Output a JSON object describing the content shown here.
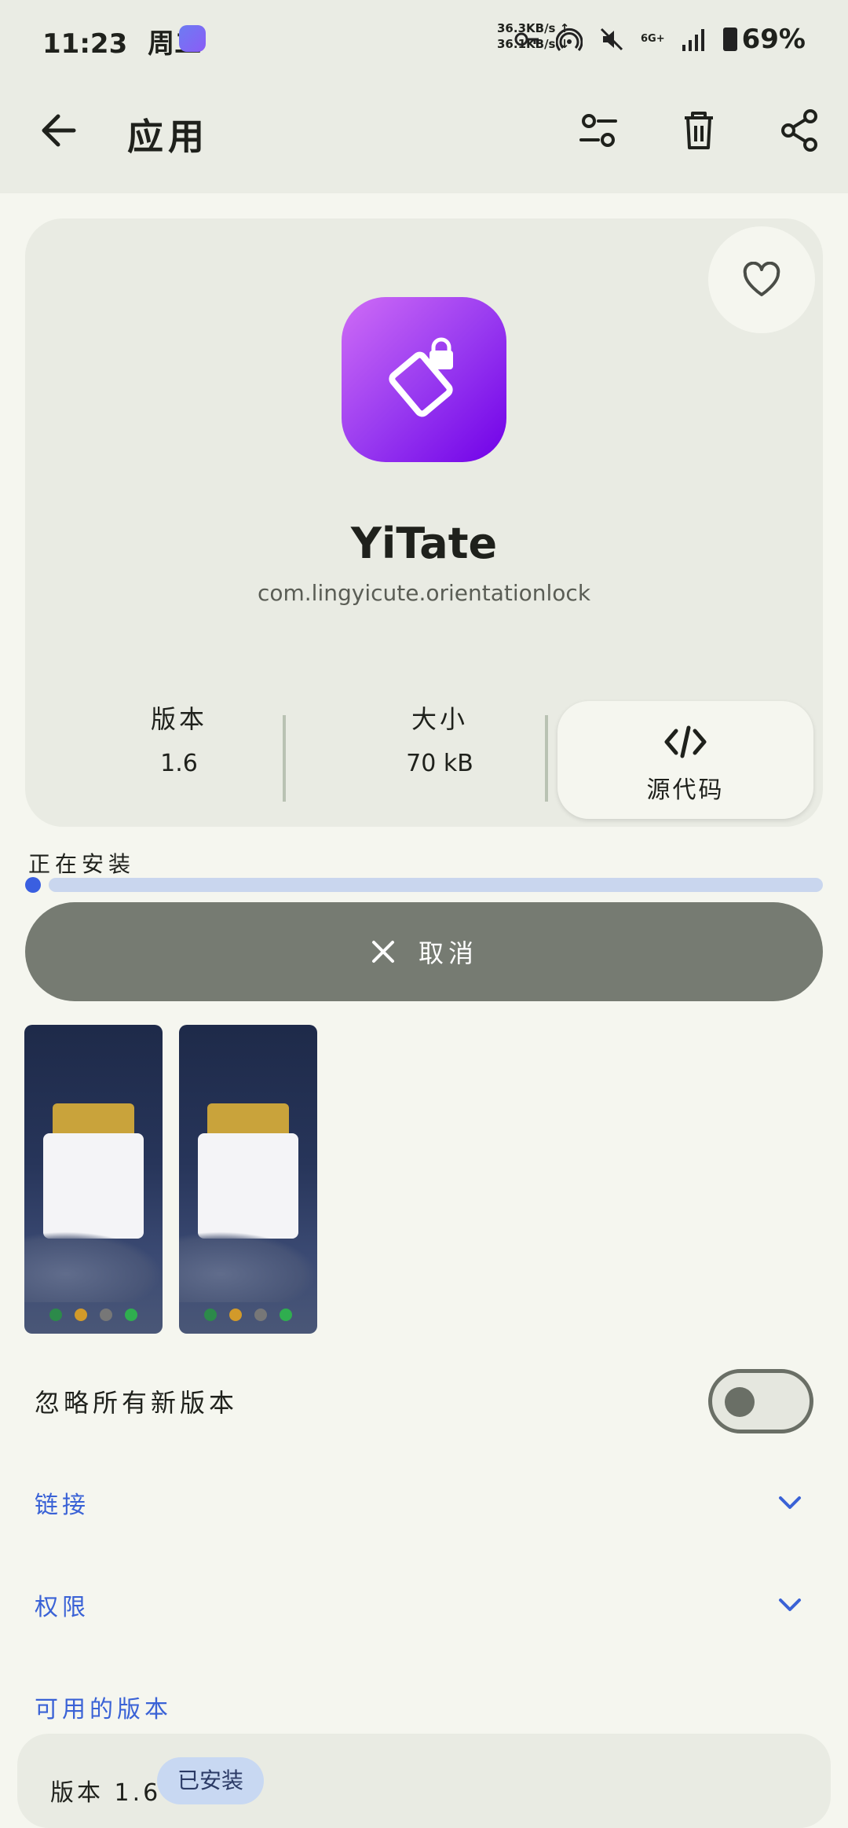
{
  "status_bar": {
    "time": "11:23",
    "weekday": "周二",
    "upload_speed": "36.3KB/s ↑",
    "download_speed": "36.1KB/s ↓",
    "network_type": "6G+",
    "battery": "69%"
  },
  "app_bar": {
    "title": "应用"
  },
  "app": {
    "name": "YiTate",
    "package": "com.lingyicute.orientationlock",
    "version_label": "版本",
    "version": "1.6",
    "size_label": "大小",
    "size": "70 kB",
    "source_label": "源代码",
    "icon_colors": [
      "#cf6cf6",
      "#7000e8"
    ]
  },
  "install": {
    "status": "正在安装",
    "progress": 0,
    "cancel_label": "取消"
  },
  "settings": {
    "ignore_updates_label": "忽略所有新版本",
    "ignore_updates_on": false
  },
  "sections": {
    "links": "链接",
    "permissions": "权限",
    "available_versions": "可用的版本"
  },
  "versions": {
    "first_label": "版本 1.6",
    "installed_badge": "已安装"
  },
  "colors": {
    "accent": "#3a62d6",
    "progress_track": "#c9d6ee",
    "cancel_bg": "#767b72"
  }
}
